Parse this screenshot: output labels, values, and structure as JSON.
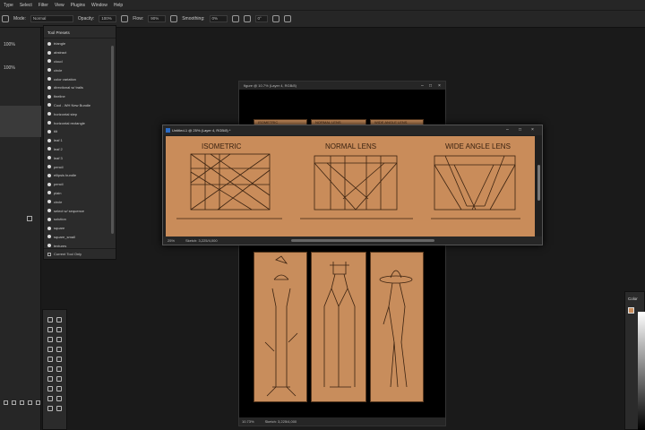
{
  "menu": [
    "Type",
    "Select",
    "Filter",
    "View",
    "Plugins",
    "Window",
    "Help"
  ],
  "options": {
    "mode_label": "Mode:",
    "mode_value": "Normal",
    "opacity_label": "Opacity:",
    "opacity_value": "100%",
    "flow_label": "Flow:",
    "flow_value": "90%",
    "smoothing_label": "Smoothing:",
    "smoothing_value": "0%",
    "angle_value": "0°"
  },
  "left_panel": {
    "value1": "100%",
    "value2": "100%"
  },
  "tool_presets": {
    "title": "Tool Presets",
    "items": [
      "triangle",
      "abstract",
      "cloud",
      "circle",
      "color variation",
      "directional w/ trails",
      "fineline",
      "Cool - WH New Bundle",
      "horizontal step",
      "horizontal rectangle",
      "tilt",
      "leaf 1",
      "leaf 2",
      "leaf 3",
      "pencil",
      "ellipsis bundle",
      "pencil",
      "plain",
      "circle",
      "select w/ sequence",
      "solution",
      "square",
      "square_small",
      "textures"
    ],
    "footer": "Current Tool Only"
  },
  "doc_back": {
    "title": "figure @ 10.7% (Layer 4, RGB/8)",
    "zoom": "10.73%",
    "sketch": "Sketch: 3,225/4,000",
    "header_labels": [
      "ISOMETRIC",
      "NORMAL LENS",
      "WIDE ANGLE LENS"
    ]
  },
  "doc_front": {
    "title": "Untitled-1 @ 25% (Layer 4, RGB/8) *",
    "zoom": "25%",
    "sketch": "Sketch: 3,225/4,000",
    "labels": [
      "ISOMETRIC",
      "NORMAL LENS",
      "WIDE ANGLE LENS"
    ]
  },
  "color_panel": {
    "title": "Color"
  },
  "colors": {
    "canvas": "#c98c5a",
    "ink": "#3a2210"
  }
}
